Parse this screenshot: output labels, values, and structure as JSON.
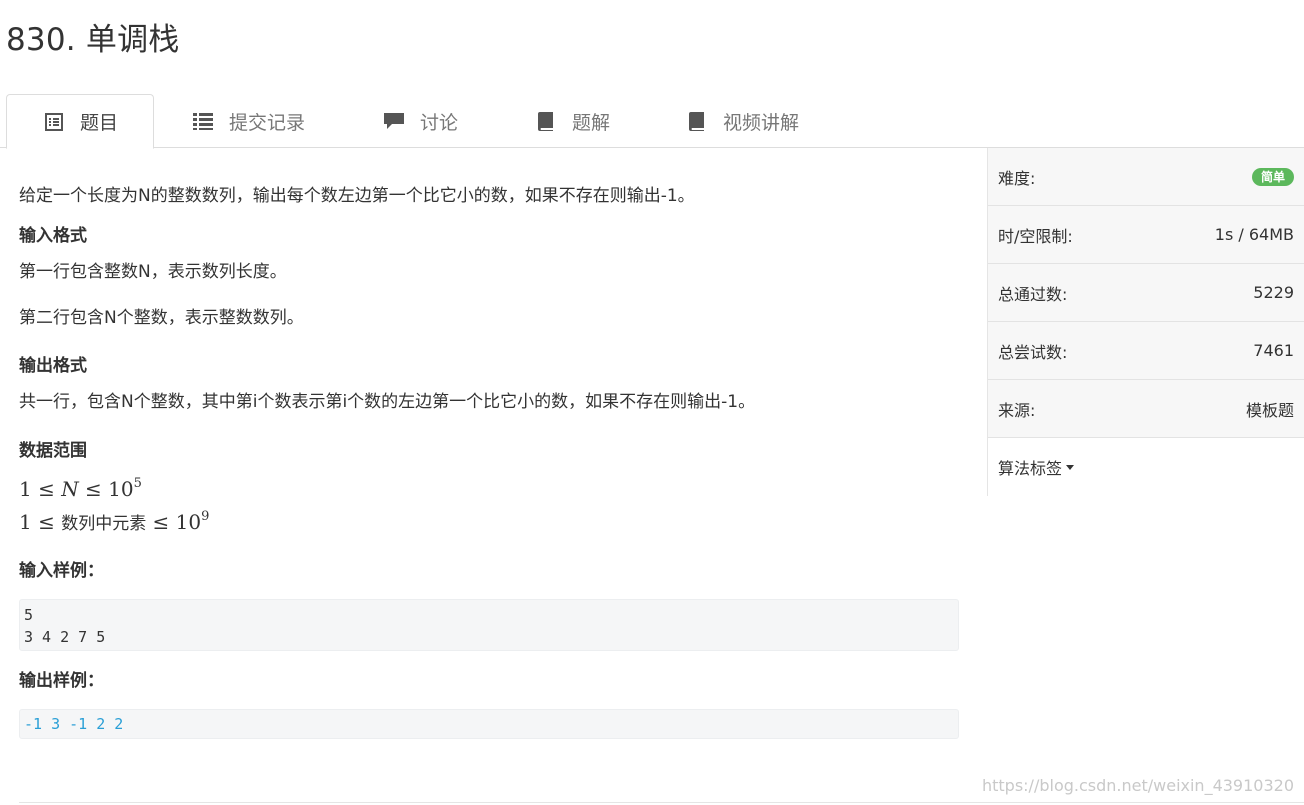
{
  "problem": {
    "title": "830. 单调栈"
  },
  "tabs": [
    {
      "label": "题目",
      "icon": "list-alt-icon"
    },
    {
      "label": "提交记录",
      "icon": "list-icon"
    },
    {
      "label": "讨论",
      "icon": "comment-icon"
    },
    {
      "label": "题解",
      "icon": "book-icon"
    },
    {
      "label": "视频讲解",
      "icon": "book-icon"
    }
  ],
  "content": {
    "description": "给定一个长度为N的整数数列，输出每个数左边第一个比它小的数，如果不存在则输出-1。",
    "input_heading": "输入格式",
    "input_line1": "第一行包含整数N，表示数列长度。",
    "input_line2": "第二行包含N个整数，表示整数数列。",
    "output_heading": "输出格式",
    "output_line": "共一行，包含N个整数，其中第i个数表示第i个数的左边第一个比它小的数，如果不存在则输出-1。",
    "range_heading": "数据范围",
    "range1": {
      "lhs": "1 ≤ ",
      "var": "N",
      "rel": " ≤ 10",
      "exp": "5"
    },
    "range2": {
      "lhs": "1 ≤ ",
      "text": "数列中元素",
      "rel": " ≤ 10",
      "exp": "9"
    },
    "sample_in_heading": "输入样例：",
    "sample_in": "5\n3 4 2 7 5",
    "sample_out_heading": "输出样例：",
    "sample_out": "-1 3 -1 2 2"
  },
  "sidebar": {
    "difficulty_label": "难度:",
    "difficulty_value": "简单",
    "limit_label": "时/空限制:",
    "limit_value": "1s / 64MB",
    "passed_label": "总通过数:",
    "passed_value": "5229",
    "tried_label": "总尝试数:",
    "tried_value": "7461",
    "source_label": "来源:",
    "source_value": "模板题",
    "tags_label": "算法标签"
  },
  "watermark": "https://blog.csdn.net/weixin_43910320",
  "colors": {
    "badge": "#5cb85c",
    "output_code": "#2a9fd6"
  }
}
